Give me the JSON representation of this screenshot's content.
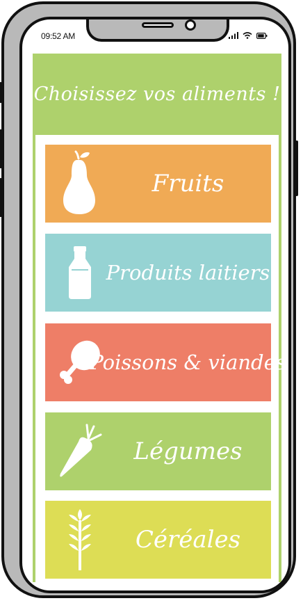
{
  "status_bar": {
    "time": "09:52 AM"
  },
  "header": {
    "title": "Choisissez vos aliments !",
    "color": "#aed16c"
  },
  "categories": [
    {
      "label": "Fruits",
      "icon": "pear-icon",
      "color": "#f0aa55"
    },
    {
      "label": "Produits laitiers",
      "icon": "milk-bottle-icon",
      "color": "#96d3d3"
    },
    {
      "label": "Poissons & viandes",
      "icon": "chicken-leg-icon",
      "color": "#ee7e67"
    },
    {
      "label": "Légumes",
      "icon": "carrot-icon",
      "color": "#aed16c"
    },
    {
      "label": "Céréales",
      "icon": "wheat-icon",
      "color": "#dddd55"
    }
  ]
}
